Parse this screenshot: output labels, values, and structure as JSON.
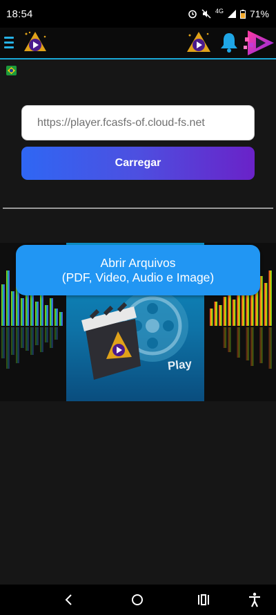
{
  "status_bar": {
    "time": "18:54",
    "network": "4G",
    "battery": "71%"
  },
  "header": {
    "menu_icon": "hamburger-menu-icon",
    "bell_icon": "notification-bell-icon"
  },
  "language_flag": "brazil-flag-icon",
  "url_input": {
    "placeholder": "https://player.fcasfs-of.cloud-fs.net",
    "value": ""
  },
  "load_button": {
    "label": "Carregar"
  },
  "banner": {
    "play_text": "Play"
  },
  "open_files_button": {
    "line1": "Abrir Arquivos",
    "line2": "(PDF, Video, Audio e Image)"
  },
  "colors": {
    "accent": "#2196f3",
    "header_border": "#19a9d9",
    "gradient_start": "#2f67f4",
    "gradient_end": "#6a22c8",
    "background": "#161616"
  },
  "nav_bar": {
    "back_icon": "back-icon",
    "home_icon": "home-icon",
    "recents_icon": "recents-icon",
    "accessibility_icon": "accessibility-icon"
  }
}
